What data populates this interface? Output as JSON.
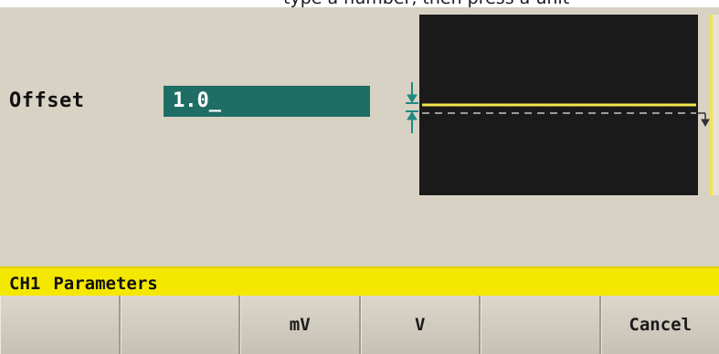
{
  "top_strip": {
    "text": "type a number, then press a unit"
  },
  "parameter": {
    "label": "Offset",
    "value": "1.0_"
  },
  "status_bar": {
    "channel": "CH1",
    "title": "Parameters"
  },
  "softkeys": [
    {
      "label": ""
    },
    {
      "label": ""
    },
    {
      "label": "mV"
    },
    {
      "label": "V"
    },
    {
      "label": ""
    },
    {
      "label": "Cancel"
    }
  ],
  "colors": {
    "panel_bg": "#d8d2c4",
    "field_bg": "#1f6e66",
    "status_bg": "#f5e800",
    "waveform": "#f2e64a",
    "offset_marker": "#1f8a82"
  },
  "icons": {
    "offset_marker": "offset-arrows-icon",
    "reference_arrow": "down-arrow-icon"
  }
}
